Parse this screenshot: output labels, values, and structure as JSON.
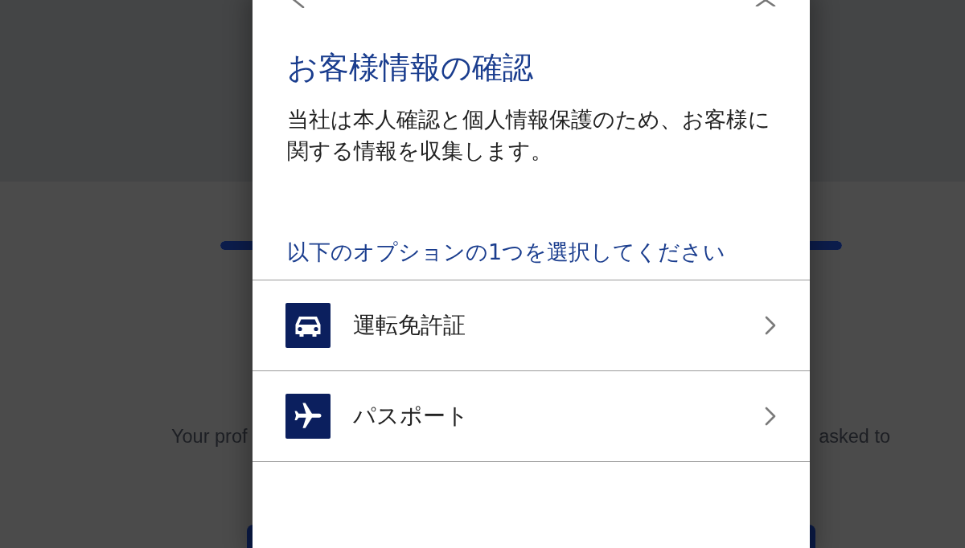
{
  "background": {
    "progress": {
      "level": 1
    },
    "message": [
      "Your prof",
      "asked to"
    ]
  },
  "dialog": {
    "title": "お客様情報の確認",
    "description": "当社は本人確認と個人情報保護のため、お客様に関する情報を収集します。",
    "prompt": "以下のオプションの1つを選択してください",
    "options": [
      {
        "kind": "car",
        "label": "運転免許証"
      },
      {
        "kind": "plane",
        "label": "パスポート"
      }
    ]
  }
}
